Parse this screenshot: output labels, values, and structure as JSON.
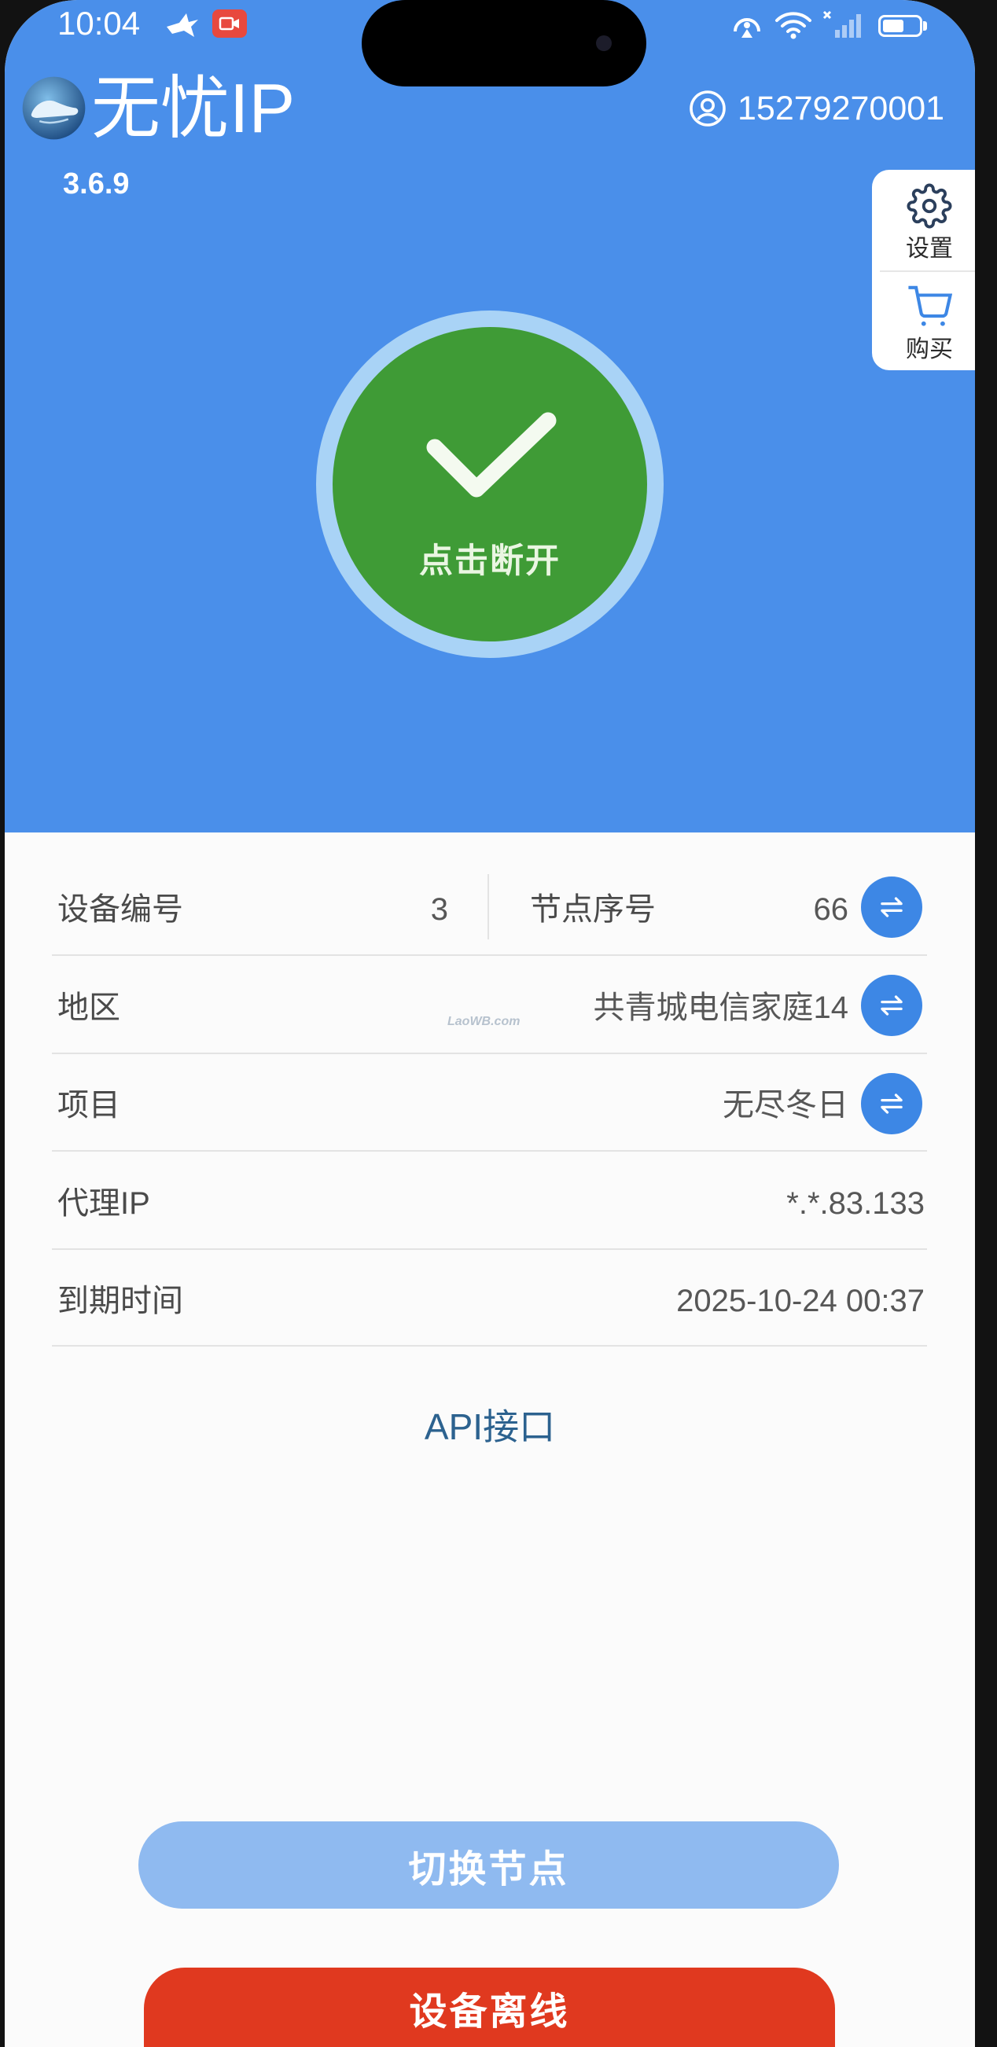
{
  "status_bar": {
    "time": "10:04",
    "battery_level": 0.6,
    "icons": [
      "bird-icon",
      "screen-record-icon",
      "hotspot-icon",
      "wifi-icon",
      "signal-icon",
      "battery-icon"
    ]
  },
  "header": {
    "app_name": "无忧IP",
    "version": "3.6.9",
    "account": "15279270001",
    "account_icon": "user-icon"
  },
  "side_panel": {
    "settings_label": "设置",
    "settings_icon": "gear-icon",
    "buy_label": "购买",
    "buy_icon": "cart-icon"
  },
  "connect_button": {
    "label": "点击断开",
    "icon": "checkmark-icon"
  },
  "info": {
    "device_number": {
      "label": "设备编号",
      "value": "3"
    },
    "node_index": {
      "label": "节点序号",
      "value": "66",
      "action_icon": "swap-icon"
    },
    "rows": [
      {
        "label": "地区",
        "value": "共青城电信家庭14",
        "action_icon": "swap-icon"
      },
      {
        "label": "项目",
        "value": "无尽冬日",
        "action_icon": "swap-icon"
      },
      {
        "label": "代理IP",
        "value": "*.*.83.133"
      },
      {
        "label": "到期时间",
        "value": "2025-10-24 00:37"
      }
    ]
  },
  "watermark": "LaoWB.com",
  "api_link": {
    "label": "API接口"
  },
  "actions": {
    "switch_node": "切换节点",
    "device_offline": "设备离线"
  },
  "colors": {
    "header_bg": "#4a8fea",
    "connected": "#3f9b36",
    "ring": "#a9d3f6",
    "accent": "#3d87e5",
    "switch_button": "#8fbaf0",
    "offline_button": "#e0391f",
    "api_link": "#2c628f"
  }
}
